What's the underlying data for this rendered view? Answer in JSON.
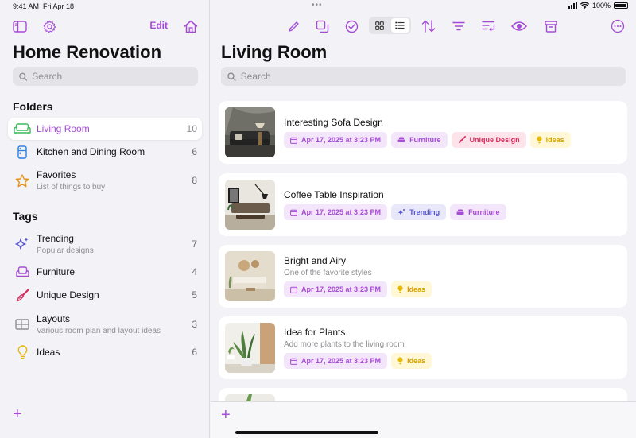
{
  "status": {
    "time": "9:41 AM",
    "date": "Fri Apr 18",
    "battery": "100%"
  },
  "colors": {
    "accent": "#a64bd6",
    "trending": "#5856d6",
    "unique": "#d42a5b",
    "ideas": "#d9a400",
    "favorites": "#e8921a",
    "kitchen": "#2f7fe0"
  },
  "sidebar": {
    "edit_label": "Edit",
    "title": "Home Renovation",
    "search_placeholder": "Search",
    "folders_title": "Folders",
    "folders": [
      {
        "icon": "sofa-icon",
        "label": "Living Room",
        "sub": "",
        "count": "10",
        "active": true
      },
      {
        "icon": "fridge-icon",
        "label": "Kitchen and Dining Room",
        "sub": "",
        "count": "6",
        "active": false
      },
      {
        "icon": "star-icon",
        "label": "Favorites",
        "sub": "List of things to buy",
        "count": "8",
        "active": false
      }
    ],
    "tags_title": "Tags",
    "tags": [
      {
        "icon": "sparkles-icon",
        "label": "Trending",
        "sub": "Popular designs",
        "count": "7"
      },
      {
        "icon": "armchair-icon",
        "label": "Furniture",
        "sub": "",
        "count": "4"
      },
      {
        "icon": "paintbrush-icon",
        "label": "Unique Design",
        "sub": "",
        "count": "5"
      },
      {
        "icon": "layout-icon",
        "label": "Layouts",
        "sub": "Various room plan and layout ideas",
        "count": "3"
      },
      {
        "icon": "lightbulb-icon",
        "label": "Ideas",
        "sub": "",
        "count": "6"
      }
    ]
  },
  "main": {
    "title": "Living Room",
    "search_placeholder": "Search",
    "cards": [
      {
        "title": "Interesting Sofa Design",
        "sub": "",
        "date": "Apr 17, 2025 at 3:23 PM",
        "tags": [
          {
            "label": "Furniture",
            "kind": "furn"
          },
          {
            "label": "Unique Design",
            "kind": "uniq"
          },
          {
            "label": "Ideas",
            "kind": "idea"
          }
        ]
      },
      {
        "title": "Coffee Table Inspiration",
        "sub": "",
        "date": "Apr 17, 2025 at 3:23 PM",
        "tags": [
          {
            "label": "Trending",
            "kind": "trend"
          },
          {
            "label": "Furniture",
            "kind": "furn"
          }
        ]
      },
      {
        "title": "Bright and Airy",
        "sub": "One of the favorite styles",
        "date": "Apr 17, 2025 at 3:23 PM",
        "tags": [
          {
            "label": "Ideas",
            "kind": "idea"
          }
        ]
      },
      {
        "title": "Idea for Plants",
        "sub": "Add more plants to the living room",
        "date": "Apr 17, 2025 at 3:23 PM",
        "tags": [
          {
            "label": "Ideas",
            "kind": "idea"
          }
        ]
      }
    ]
  }
}
